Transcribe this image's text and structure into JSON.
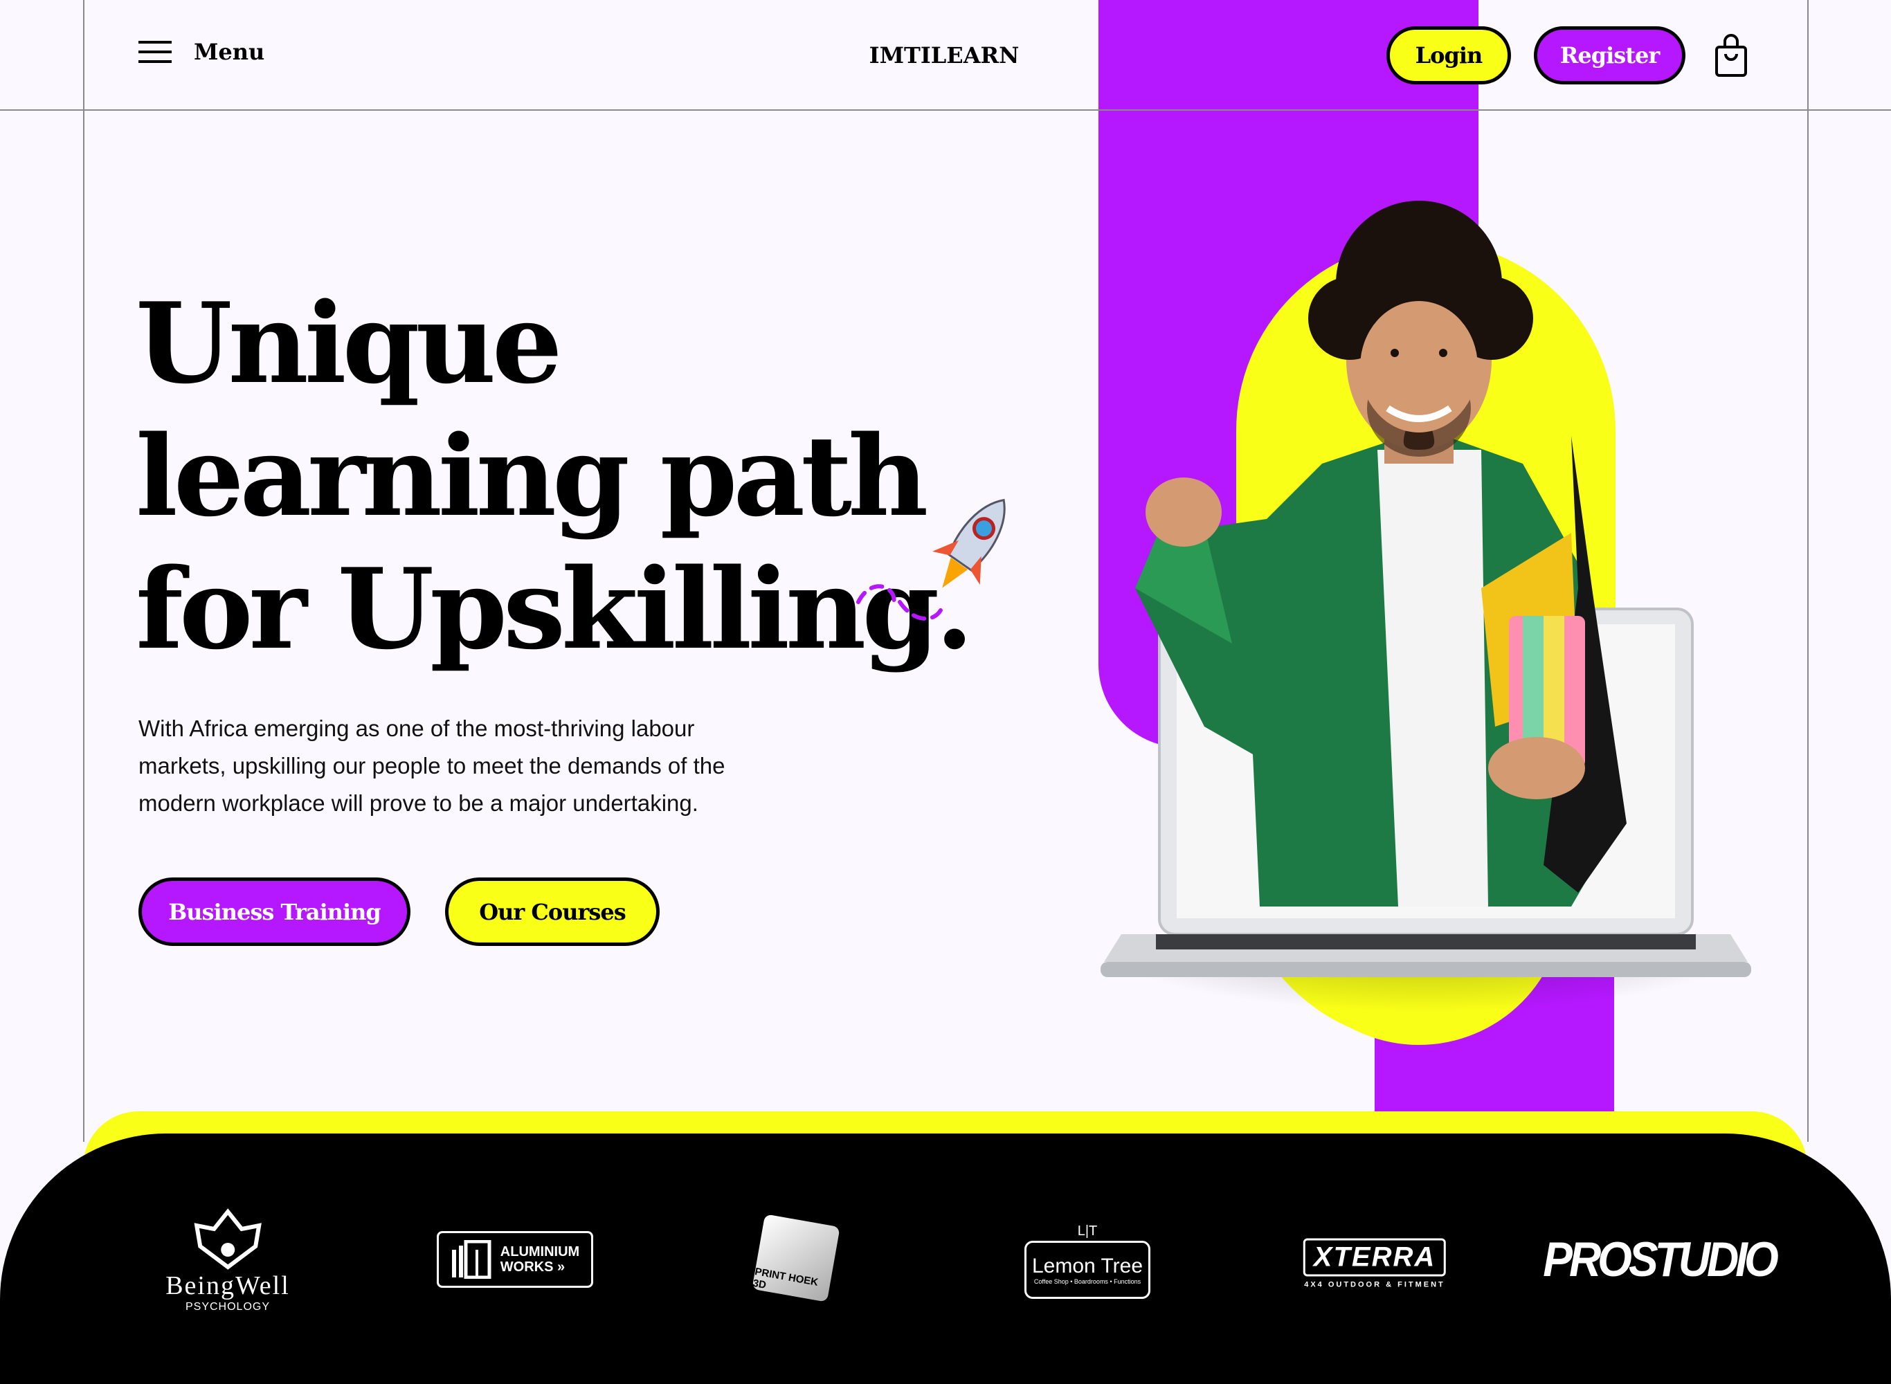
{
  "header": {
    "menu_label": "Menu",
    "brand": "IMTILEARN",
    "login_label": "Login",
    "register_label": "Register",
    "cart_icon": "shopping-bag-icon",
    "menu_icon": "hamburger-icon"
  },
  "hero": {
    "title_lines": [
      "Unique",
      "learning path",
      "for Upskilling."
    ],
    "description_lines": [
      "With Africa emerging as one of the most-thriving labour",
      "markets, upskilling our people to meet the demands of the",
      "modern workplace will prove to be a major undertaking."
    ],
    "primary_button": "Business Training",
    "secondary_button": "Our Courses"
  },
  "partners": [
    {
      "name": "BeingWell",
      "sub": "PSYCHOLOGY"
    },
    {
      "name": "ALUMINIUM",
      "sub": "WORKS »"
    },
    {
      "name": "PRINT HOEK 3D",
      "sub": ""
    },
    {
      "name": "Lemon Tree",
      "sub": "Coffee Shop • Boardrooms • Functions",
      "mark": "L|T"
    },
    {
      "name": "XTERRA",
      "sub": "4X4 OUTDOOR & FITMENT"
    },
    {
      "name": "PROSTUDIO",
      "sub": ""
    }
  ],
  "colors": {
    "purple": "#b517ff",
    "yellow": "#f9ff17",
    "black": "#000000",
    "background": "#fbf9ff"
  }
}
